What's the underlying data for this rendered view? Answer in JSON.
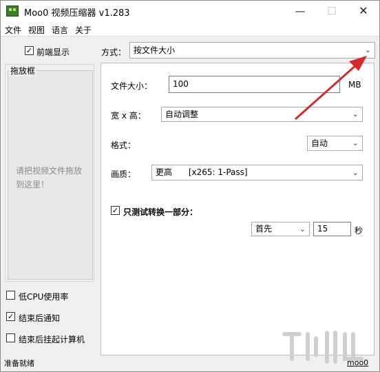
{
  "window": {
    "title": "Moo0 视频压缩器 v1.283",
    "min_glyph": "—",
    "max_glyph": "☐",
    "close_glyph": "✕"
  },
  "menu": [
    "文件",
    "视图",
    "语言",
    "关于"
  ],
  "left": {
    "always_on_top": {
      "label": "前端显示",
      "checked": true
    },
    "drop_zone": {
      "title": "拖放框",
      "hint": "请把视频文件拖放到这里！"
    },
    "low_cpu": {
      "label": "低CPU使用率",
      "checked": false
    },
    "notify_done": {
      "label": "结束后通知",
      "checked": true
    },
    "suspend_after": {
      "label": "结束后挂起计算机",
      "checked": false
    }
  },
  "mode": {
    "label": "方式：",
    "value": "按文件大小"
  },
  "form": {
    "file_size": {
      "label": "文件大小：",
      "value": "100",
      "unit": "MB"
    },
    "dimensions": {
      "label": "宽 x 高：",
      "value": "自动调整"
    },
    "format": {
      "label": "格式：",
      "value": "自动"
    },
    "quality": {
      "label": "画质：",
      "value": "更高",
      "detail": "[x265: 1-Pass]"
    },
    "partial_test": {
      "label": "只测试转换一部分：",
      "checked": true
    },
    "segment": {
      "position": "首先",
      "value": "15",
      "unit": "秒"
    }
  },
  "status": {
    "text": "准备就绪",
    "brand": "moo0"
  },
  "colors": {
    "arrow": "#d42a2a",
    "checkmark": "#000000"
  }
}
